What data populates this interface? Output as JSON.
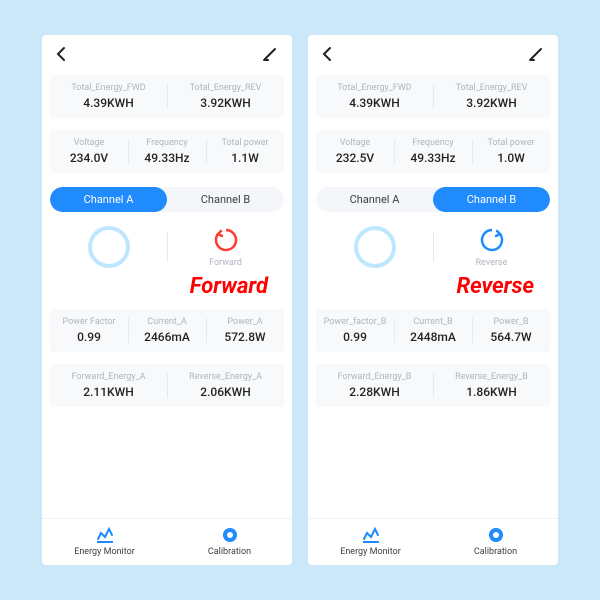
{
  "left": {
    "totals": {
      "fwd_label": "Total_Energy_FWD",
      "fwd_value": "4.39KWH",
      "rev_label": "Total_Energy_REV",
      "rev_value": "3.92KWH"
    },
    "stats": {
      "voltage_label": "Voltage",
      "voltage_value": "234.0V",
      "freq_label": "Frequency",
      "freq_value": "49.33Hz",
      "power_label": "Total power",
      "power_value": "1.1W"
    },
    "tabs": {
      "a": "Channel A",
      "b": "Channel B"
    },
    "direction_label": "Forward",
    "big_label": "Forward",
    "row1": {
      "pf_label": "Power Factor",
      "pf_value": "0.99",
      "cur_label": "Current_A",
      "cur_value": "2466mA",
      "pow_label": "Power_A",
      "pow_value": "572.8W"
    },
    "row2": {
      "fe_label": "Forward_Energy_A",
      "fe_value": "2.11KWH",
      "re_label": "Reverse_Energy_A",
      "re_value": "2.06KWH"
    }
  },
  "right": {
    "totals": {
      "fwd_label": "Total_Energy_FWD",
      "fwd_value": "4.39KWH",
      "rev_label": "Total_Energy_REV",
      "rev_value": "3.92KWH"
    },
    "stats": {
      "voltage_label": "Voltage",
      "voltage_value": "232.5V",
      "freq_label": "Frequency",
      "freq_value": "49.33Hz",
      "power_label": "Total power",
      "power_value": "1.0W"
    },
    "tabs": {
      "a": "Channel A",
      "b": "Channel B"
    },
    "direction_label": "Reverse",
    "big_label": "Reverse",
    "row1": {
      "pf_label": "Power_factor_B",
      "pf_value": "0.99",
      "cur_label": "Current_B",
      "cur_value": "2448mA",
      "pow_label": "Power_B",
      "pow_value": "564.7W"
    },
    "row2": {
      "fe_label": "Forward_Energy_B",
      "fe_value": "2.28KWH",
      "re_label": "Reverse_Energy_B",
      "re_value": "1.86KWH"
    }
  },
  "nav": {
    "monitor": "Energy Monitor",
    "calibration": "Calibration"
  }
}
